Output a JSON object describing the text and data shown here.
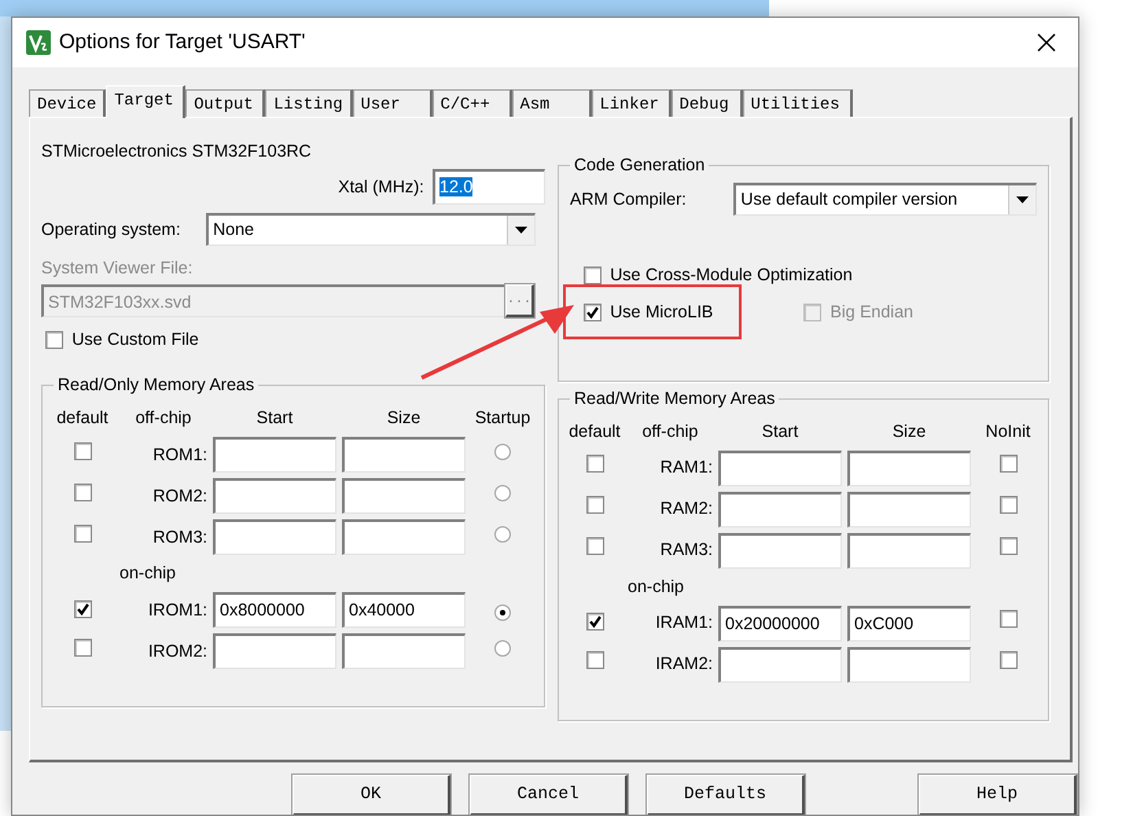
{
  "window": {
    "title": "Options for Target 'USART'"
  },
  "tabs": [
    {
      "label": "Device",
      "selected": false
    },
    {
      "label": "Target",
      "selected": true
    },
    {
      "label": "Output",
      "selected": false
    },
    {
      "label": "Listing",
      "selected": false
    },
    {
      "label": "User",
      "selected": false
    },
    {
      "label": "C/C++",
      "selected": false
    },
    {
      "label": "Asm",
      "selected": false
    },
    {
      "label": "Linker",
      "selected": false
    },
    {
      "label": "Debug",
      "selected": false
    },
    {
      "label": "Utilities",
      "selected": false
    }
  ],
  "device": "STMicroelectronics STM32F103RC",
  "xtal": {
    "label": "Xtal (MHz):",
    "value": "12.0",
    "text_selected": true
  },
  "operating_system": {
    "label": "Operating system:",
    "value": "None"
  },
  "system_viewer": {
    "label": "System Viewer File:",
    "value": "STM32F103xx.svd",
    "browse": "...",
    "disabled": true
  },
  "use_custom_file": {
    "label": "Use Custom File",
    "checked": false
  },
  "code_generation": {
    "title": "Code Generation",
    "compiler_label": "ARM Compiler:",
    "compiler": "Use default compiler version",
    "options": [
      {
        "label": "Use Cross-Module Optimization",
        "checked": false,
        "disabled": false,
        "highlighted": false
      },
      {
        "label": "Use MicroLIB",
        "checked": true,
        "disabled": false,
        "highlighted": true
      },
      {
        "label": "Big Endian",
        "checked": false,
        "disabled": true,
        "highlighted": false
      }
    ]
  },
  "rom_areas": {
    "title": "Read/Only Memory Areas",
    "columns": [
      "default",
      "off-chip",
      "Start",
      "Size",
      "Startup"
    ],
    "section_label": "on-chip",
    "rows": [
      {
        "label": "ROM1:",
        "default": false,
        "selected": false
      },
      {
        "label": "ROM2:",
        "default": false,
        "selected": false
      },
      {
        "label": "ROM3:",
        "default": false,
        "selected": false
      },
      {
        "label": "IROM1:",
        "default": true,
        "start": "0x8000000",
        "size": "0x40000",
        "selected": true
      },
      {
        "label": "IROM2:",
        "default": false,
        "selected": false
      }
    ]
  },
  "ram_areas": {
    "title": "Read/Write Memory Areas",
    "columns": [
      "default",
      "off-chip",
      "Start",
      "Size",
      "NoInit"
    ],
    "section_label": "on-chip",
    "rows": [
      {
        "label": "RAM1:",
        "default": false,
        "no_init": false
      },
      {
        "label": "RAM2:",
        "default": false,
        "no_init": false
      },
      {
        "label": "RAM3:",
        "default": false,
        "no_init": false
      },
      {
        "label": "IRAM1:",
        "default": true,
        "start": "0x20000000",
        "size": "0xC000",
        "no_init": false
      },
      {
        "label": "IRAM2:",
        "default": false,
        "no_init": false
      }
    ]
  },
  "buttons": [
    "OK",
    "Cancel",
    "Defaults",
    "Help"
  ]
}
